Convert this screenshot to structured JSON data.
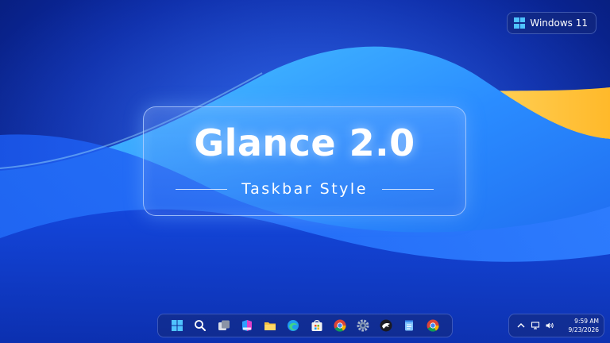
{
  "os_badge": {
    "label": "Windows 11",
    "icon": "windows-logo-icon"
  },
  "title_card": {
    "title": "Glance 2.0",
    "subtitle": "Taskbar Style"
  },
  "taskbar": {
    "icons": [
      "start-icon",
      "search-icon",
      "task-view-icon",
      "copilot-icon",
      "file-explorer-icon",
      "edge-icon",
      "store-icon",
      "chrome-icon",
      "settings-icon",
      "eagle-app-icon",
      "notepad-icon",
      "chrome-icon"
    ]
  },
  "tray": {
    "icons": [
      "chevron-up-icon",
      "network-icon",
      "volume-icon"
    ],
    "time": "9:59 AM",
    "date": "9/23/2026"
  },
  "colors": {
    "wallpaper_deep": "#071a6e",
    "wallpaper_mid": "#1e4fe0",
    "wave_light": "#3fb6ff",
    "wave_accent": "#ffc94a",
    "windows_blue": "#4fc3ff"
  }
}
